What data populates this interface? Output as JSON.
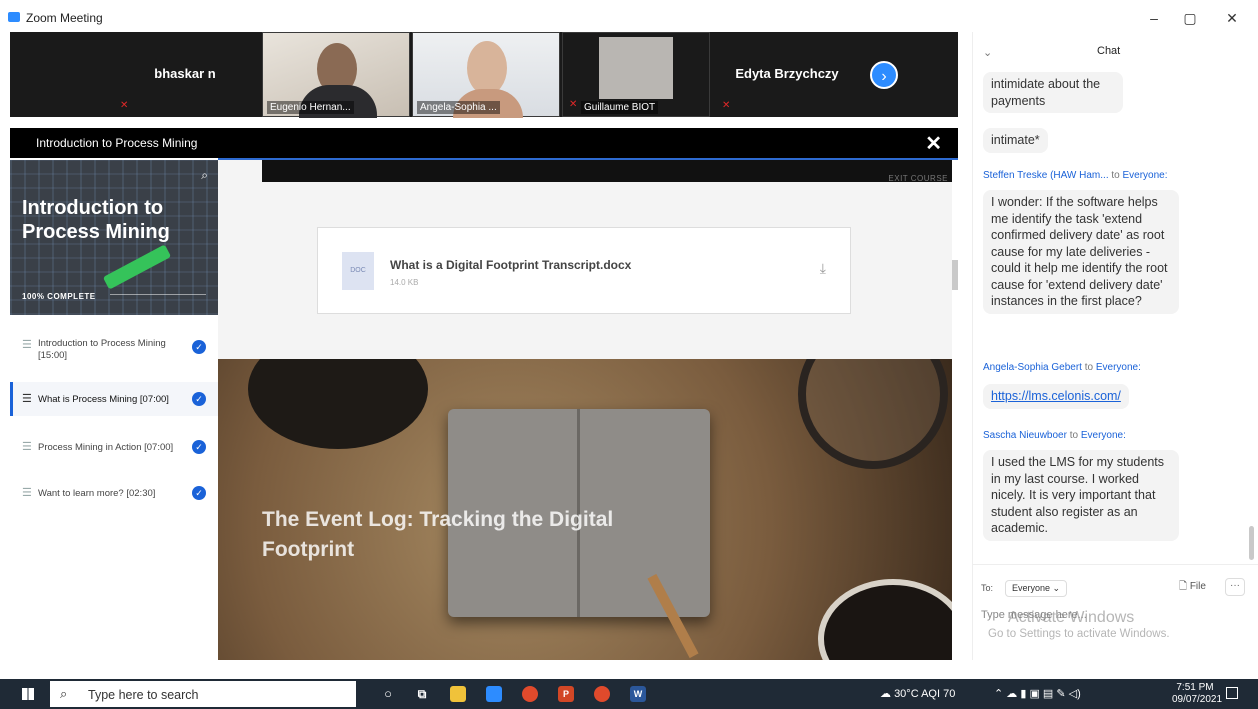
{
  "window": {
    "title": "Zoom Meeting",
    "controls": [
      "–",
      "▢",
      "✕"
    ]
  },
  "participants": [
    {
      "name": "bhaskar n",
      "muted": true,
      "video": false
    },
    {
      "name": "Eugenio Hernan...",
      "muted": false,
      "video": true
    },
    {
      "name": "Angela-Sophia ...",
      "muted": false,
      "video": true
    },
    {
      "name": "Guillaume BIOT",
      "muted": true,
      "video": true
    },
    {
      "name": "Edyta Brzychczy",
      "muted": true,
      "video": false
    }
  ],
  "course": {
    "header_title": "Introduction to Process Mining",
    "hero_title": "Introduction to Process Mining",
    "complete": "100% COMPLETE",
    "lessons": [
      {
        "label": "Introduction to Process Mining [15:00]",
        "done": true,
        "active": false
      },
      {
        "label": "What is Process Mining [07:00]",
        "done": true,
        "active": true
      },
      {
        "label": "Process Mining in Action [07:00]",
        "done": true,
        "active": false
      },
      {
        "label": "Want to learn more? [02:30]",
        "done": true,
        "active": false
      }
    ],
    "exit": "EXIT COURSE",
    "file": {
      "type": "DOC",
      "name": "What is a Digital Footprint Transcript.docx",
      "size": "14.0 KB"
    },
    "section_title": "The Event Log: Tracking the Digital Footprint"
  },
  "chat": {
    "title": "Chat",
    "messages": [
      {
        "kind": "bubble",
        "text": "intimidate about the payments"
      },
      {
        "kind": "bubble",
        "text": "intimate*"
      },
      {
        "kind": "from",
        "sender": "Steffen Treske (HAW Ham...",
        "to_word": "to",
        "recipient": "Everyone:"
      },
      {
        "kind": "bubble",
        "text": "I wonder: If the software helps me identify the task 'extend confirmed delivery date' as root cause for my late deliveries - could it help me identify the root cause for 'extend delivery date' instances in the first place?"
      },
      {
        "kind": "from",
        "sender": "Angela-Sophia Gebert",
        "to_word": "to",
        "recipient": "Everyone:"
      },
      {
        "kind": "link",
        "text": "https://lms.celonis.com/"
      },
      {
        "kind": "from",
        "sender": "Sascha Nieuwboer",
        "to_word": "to",
        "recipient": "Everyone:"
      },
      {
        "kind": "bubble",
        "text": "I used the LMS for my students in my last course. I worked nicely. It is very important that student also register as an academic."
      }
    ],
    "to_label": "To:",
    "recipient_select": "Everyone ⌄",
    "file_label": "File",
    "more_label": "···",
    "placeholder": "Type message here...",
    "watermark_title": "Activate Windows",
    "watermark_sub": "Go to Settings to activate Windows."
  },
  "taskbar": {
    "search_placeholder": "Type here to search",
    "weather": "30°C AQI 70",
    "time": "7:51 PM",
    "date": "09/07/2021",
    "accent": "#1f2a36"
  }
}
